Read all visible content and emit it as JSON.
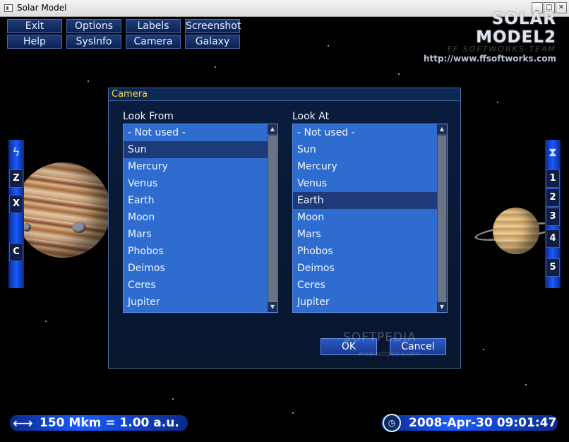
{
  "window": {
    "title": "Solar Model"
  },
  "menu": {
    "row1": [
      "Exit",
      "Options",
      "Labels",
      "Screenshot"
    ],
    "row2": [
      "Help",
      "SysInfo",
      "Camera",
      "Galaxy"
    ]
  },
  "logo": {
    "main": "SOLAR MODEL2",
    "team": "FF SOFTWORKS TEAM",
    "url": "http://www.ffsoftworks.com"
  },
  "left_panel": {
    "axis_buttons": [
      "Z",
      "X",
      "C"
    ],
    "icon": "lightning-icon"
  },
  "right_panel": {
    "speed_buttons": [
      "1",
      "2",
      "3",
      "4",
      "5"
    ],
    "icon": "hourglass-icon"
  },
  "dialog": {
    "title": "Camera",
    "look_from": {
      "label": "Look From",
      "items": [
        "- Not used -",
        "Sun",
        "Mercury",
        "Venus",
        "Earth",
        "Moon",
        "Mars",
        "Phobos",
        "Deimos",
        "Ceres",
        "Jupiter"
      ],
      "selected": "Sun"
    },
    "look_at": {
      "label": "Look At",
      "items": [
        "- Not used -",
        "Sun",
        "Mercury",
        "Venus",
        "Earth",
        "Moon",
        "Mars",
        "Phobos",
        "Deimos",
        "Ceres",
        "Jupiter"
      ],
      "selected": "Earth"
    },
    "ok_label": "OK",
    "cancel_label": "Cancel"
  },
  "watermark": {
    "text": "SOFTPEDIA",
    "sub": "www.softpedia.com"
  },
  "status": {
    "scale": "150 Mkm = 1.00 a.u.",
    "datetime": "2008-Apr-30 09:01:47"
  }
}
